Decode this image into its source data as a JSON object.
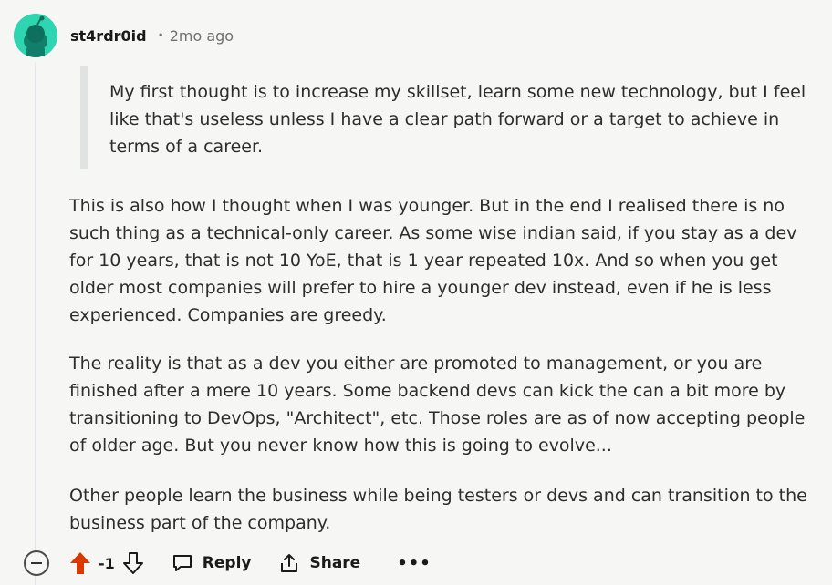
{
  "comment": {
    "username": "st4rdr0id",
    "separator": "•",
    "timestamp": "2mo ago",
    "quote": "My first thought is to increase my skillset, learn some new technology, but I feel like that's useless unless I have a clear path forward or a target to achieve in terms of a career.",
    "paragraphs": [
      "This is also how I thought when I was younger. But in the end I realised there is no such thing as a technical-only career. As some wise indian said, if you stay as a dev for 10 years, that is not 10 YoE, that is 1 year repeated 10x. And so when you get older most companies will prefer to hire a younger dev instead, even if he is less experienced. Companies are greedy.",
      "The reality is that as a dev you either are promoted to management, or you are finished after a mere 10 years. Some backend devs can kick the can a bit more by transitioning to DevOps, \"Architect\", etc. Those roles are as of now accepting people of older age. But you never know how this is going to evolve...",
      "Other people learn the business while being testers or devs and can transition to the business part of the company."
    ]
  },
  "actions": {
    "score": "-1",
    "reply_label": "Reply",
    "share_label": "Share",
    "more_label": "•••"
  },
  "colors": {
    "avatar": "#2fd4b1",
    "upvote_active": "#d93900"
  },
  "icons": [
    "avatar-icon",
    "collapse-icon",
    "upvote-icon",
    "downvote-icon",
    "reply-icon",
    "share-icon",
    "more-icon"
  ]
}
